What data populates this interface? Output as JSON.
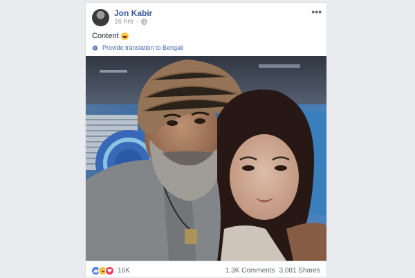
{
  "post": {
    "author": "Jon Kabir",
    "time": "16 hrs",
    "privacy_icon": "globe-icon",
    "more_icon": "more-options-icon",
    "more_label": "•••",
    "text": "Content",
    "text_emoji": "rolling-on-floor-laughing-emoji",
    "translate_label": "Provide translation to Bengali",
    "translate_icon": "gear-icon"
  },
  "footer": {
    "reactions": [
      "like-reaction-icon",
      "haha-reaction-icon",
      "love-reaction-icon"
    ],
    "reaction_count": "16K",
    "comments": "1.3K Comments",
    "shares": "3,081 Shares"
  },
  "colors": {
    "link_blue": "#385898",
    "secondary_text": "#90949c",
    "page_bg": "#e9ebee"
  }
}
